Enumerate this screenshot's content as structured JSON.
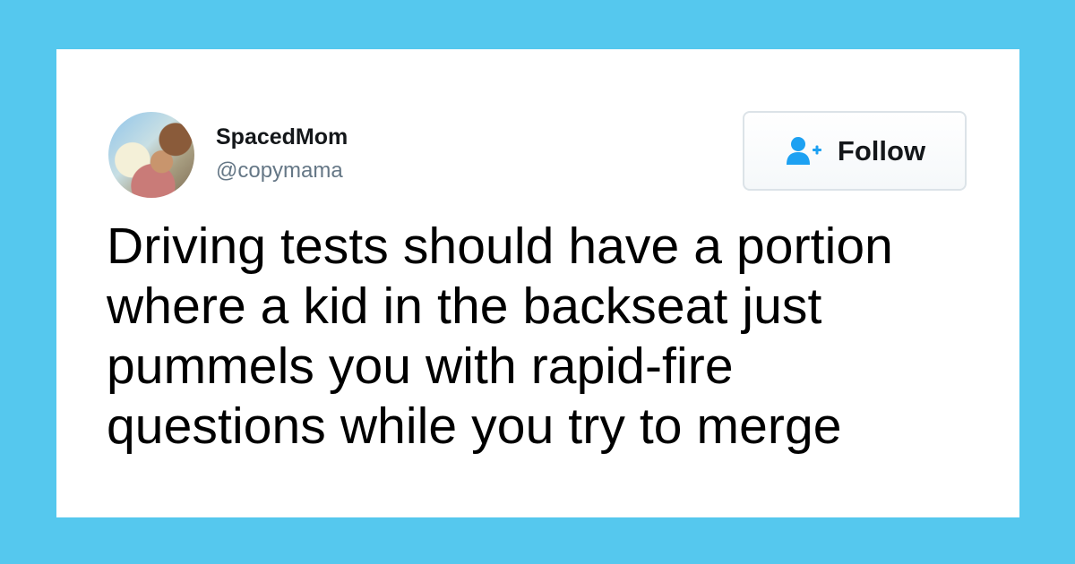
{
  "tweet": {
    "author": {
      "name": "SpacedMom",
      "handle": "@copymama"
    },
    "follow_button": {
      "label": "Follow",
      "icon": "add-user-icon"
    },
    "text": "Driving tests should have a portion\nwhere a kid in the backseat just\npummels you with rapid-fire\nquestions while you try to merge"
  },
  "colors": {
    "background": "#55c8ee",
    "card": "#ffffff",
    "text": "#000000",
    "secondary_text": "#657786",
    "button_icon": "#1da1f2"
  }
}
